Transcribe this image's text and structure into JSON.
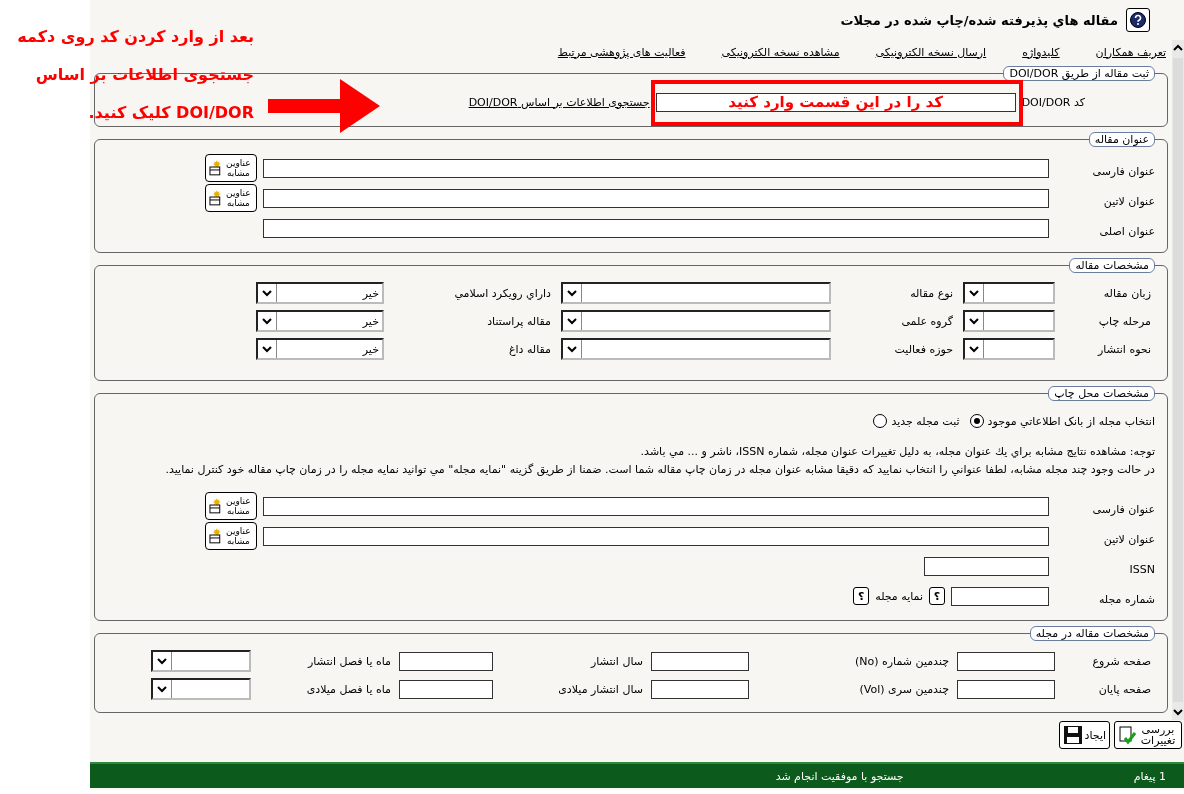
{
  "annotations": {
    "instruction_lines": [
      "بعد از وارد کردن کد روی دکمه",
      "جستجوی اطلاعات بر اساس",
      "DOI/DOR کلیک کنید."
    ],
    "field_hint": "کد را در این قسمت وارد کنید"
  },
  "header": {
    "title": "مقاله هاي پذيرفته شده/چاپ شده در مجلات"
  },
  "links": [
    "تعریف همکاران",
    "کلیدواژه",
    "ارسال نسخه الکترونیکی",
    "مشاهده نسخه الکترونیکی",
    "فعالیت های پژوهشی مرتبط"
  ],
  "doi_section": {
    "legend": "ثبت مقاله از طریق DOI/DOR",
    "code_label": "کد DOI/DOR",
    "search_link": "جستجوی اطلاعات بر اساس DOI/DOR"
  },
  "title_section": {
    "legend": "عنوان مقاله",
    "rows": [
      {
        "label": "عنوان فارسی",
        "similar_button": "عناوین مشابه"
      },
      {
        "label": "عنوان لاتین",
        "similar_button": "عناوین مشابه"
      },
      {
        "label": "عنوان اصلی"
      }
    ]
  },
  "specs": {
    "legend": "مشخصات مقاله",
    "rows": [
      [
        {
          "label": "زبان مقاله"
        },
        {
          "label": "نوع مقاله"
        },
        {
          "label": "داراي رويكرد اسلامي",
          "value": "خیر"
        }
      ],
      [
        {
          "label": "مرحله چاپ"
        },
        {
          "label": "گروه علمی"
        },
        {
          "label": "مقاله پراستناد",
          "value": "خیر"
        }
      ],
      [
        {
          "label": "نحوه انتشار"
        },
        {
          "label": "حوزه فعالیت"
        },
        {
          "label": "مقاله داغ",
          "value": "خیر"
        }
      ]
    ]
  },
  "venue": {
    "legend": "مشخصات محل چاپ",
    "options": [
      {
        "label": "انتخاب مجله از بانک اطلاعاتي موجود",
        "selected": true
      },
      {
        "label": "ثبت مجله جدید",
        "selected": false
      }
    ],
    "notes": [
      "توجه: مشاهده نتايج مشابه براي يك عنوان مجله، به دليل تغييرات عنوان مجله، شماره ISSN، ناشر و ... مي باشد.",
      "در حالت وجود چند مجله مشابه، لطفا عنواني را انتخاب نماييد كه دقيقا مشابه عنوان مجله در زمان چاپ مقاله شما است. ضمنا از طريق گزينه \"نمايه مجله\" مي توانيد نمايه مجله را در زمان چاپ مقاله خود كنترل نماييد."
    ],
    "rows": [
      {
        "kind": "title",
        "label": "عنوان فارسی",
        "similar_button": "عناوین مشابه"
      },
      {
        "kind": "title",
        "label": "عنوان لاتین",
        "similar_button": "عناوین مشابه"
      },
      {
        "kind": "short",
        "label": "ISSN"
      },
      {
        "kind": "journal",
        "label": "شماره مجله",
        "help": "؟",
        "index_label": "نمایه مجله",
        "index_help": "؟"
      }
    ]
  },
  "in_journal": {
    "legend": "مشخصات مقاله در مجله",
    "rows": [
      [
        {
          "label": "صفحه شروع",
          "kind": "input"
        },
        {
          "label": "چندمین شماره (No)",
          "kind": "input"
        },
        {
          "label": "سال انتشار",
          "kind": "input"
        },
        {
          "label": "ماه يا فصل انتشار",
          "kind": "select"
        }
      ],
      [
        {
          "label": "صفحه پایان",
          "kind": "input"
        },
        {
          "label": "چندمین سری (Vol)",
          "kind": "input"
        },
        {
          "label": "سال انتشار میلادی",
          "kind": "input"
        },
        {
          "label": "ماه یا فصل میلادی",
          "kind": "select"
        }
      ]
    ]
  },
  "actions": [
    {
      "label": "بررسی تغییرات",
      "kind": "review"
    },
    {
      "label": "ایجاد",
      "kind": "save"
    }
  ],
  "status": {
    "count": "1 پیغام",
    "message": "جستجو با موفقیت انجام شد"
  }
}
